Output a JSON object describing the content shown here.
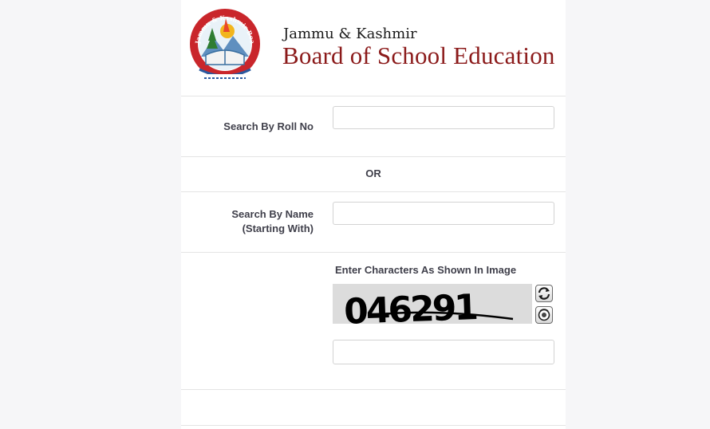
{
  "header": {
    "logo_text": "Jammu & Kashmir Board Of School Education",
    "brand_sub": "Jammu & Kashmir",
    "brand_main": "Board of School Education"
  },
  "form": {
    "roll_no_label": "Search By Roll No",
    "roll_no_value": "",
    "or_label": "OR",
    "name_label_line1": "Search By Name",
    "name_label_line2": "(Starting With)",
    "name_value": "",
    "captcha_label": "Enter Characters As Shown In Image",
    "captcha_text": "046291",
    "captcha_value": ""
  },
  "icons": {
    "refresh": "refresh-icon",
    "audio": "audio-icon"
  },
  "colors": {
    "brand": "#8b1a1a",
    "label": "#3f3f4a",
    "background": "#f6f6f8"
  }
}
